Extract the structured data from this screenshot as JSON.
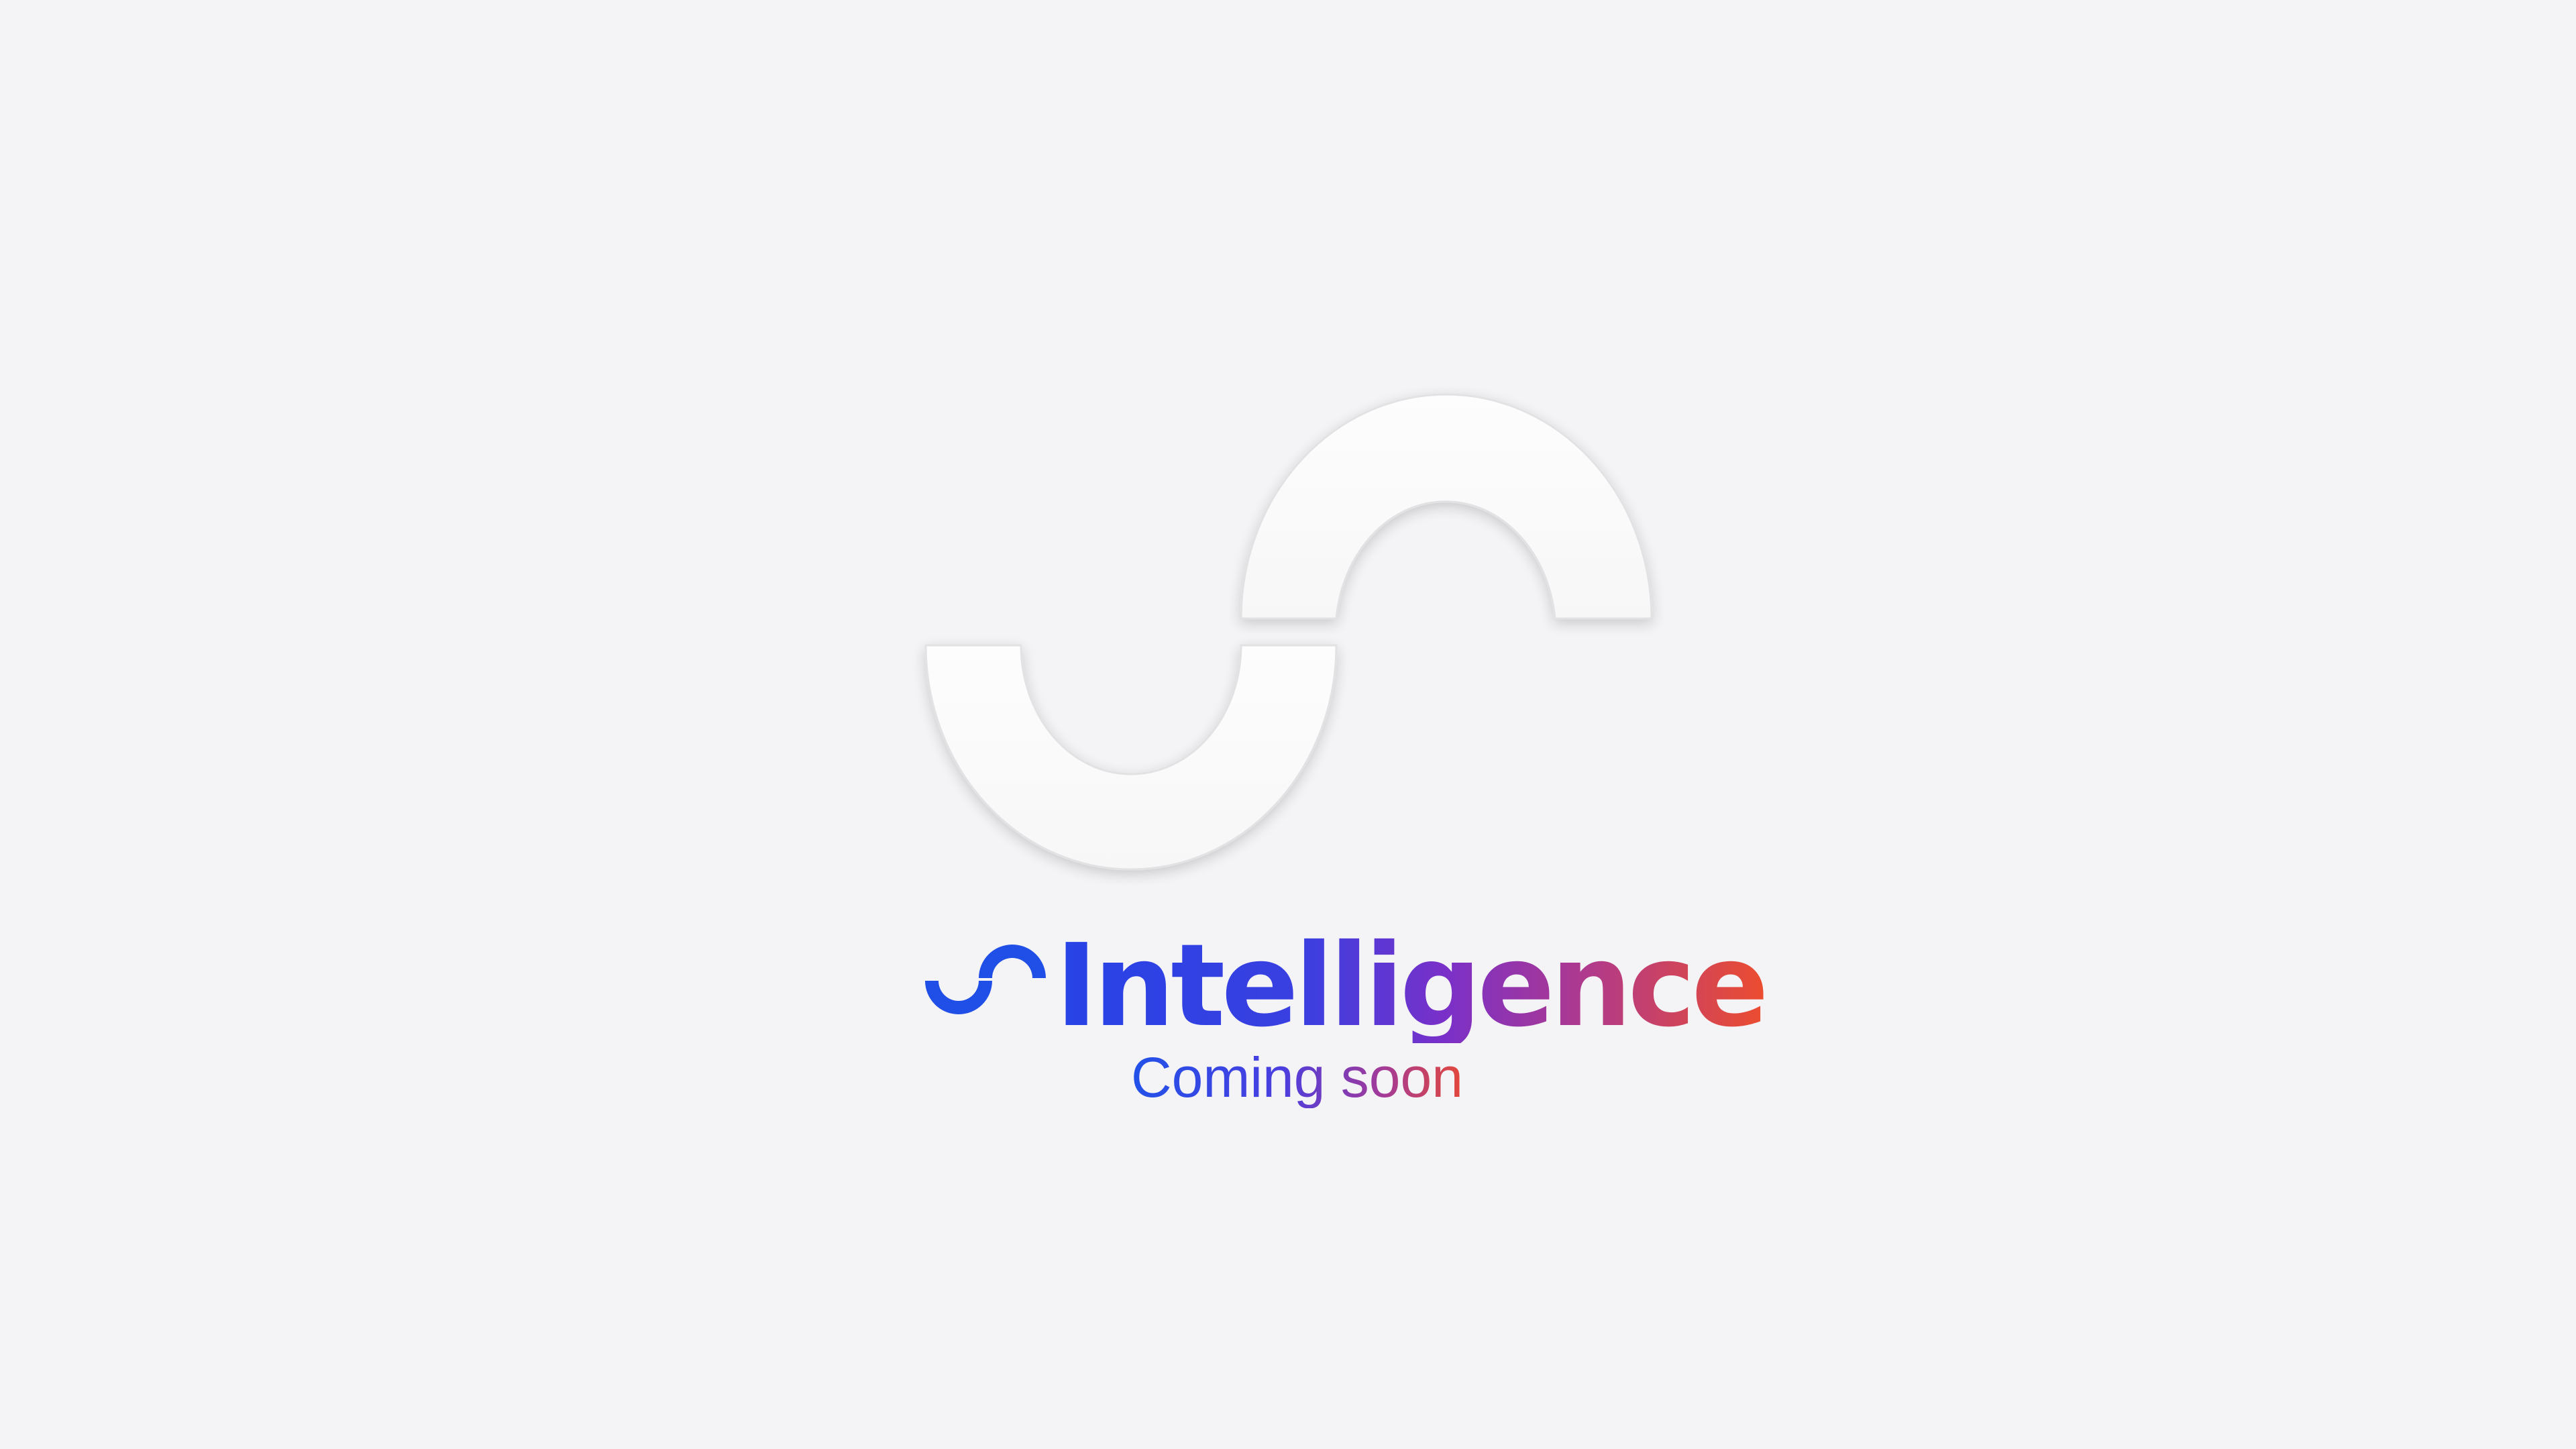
{
  "brand": {
    "name": "Intelligence",
    "tagline": "Coming soon",
    "logo_icon": "s-wave-logo-icon",
    "hero_icon": "s-wave-embossed-icon"
  },
  "colors": {
    "background": "#f4f4f6",
    "hero_fill": "#fbfbfb",
    "gradient_start": "#2743e6",
    "gradient_mid": "#7a30c8",
    "gradient_end": "#ec4d2f",
    "logo": "#1f4fe6"
  }
}
